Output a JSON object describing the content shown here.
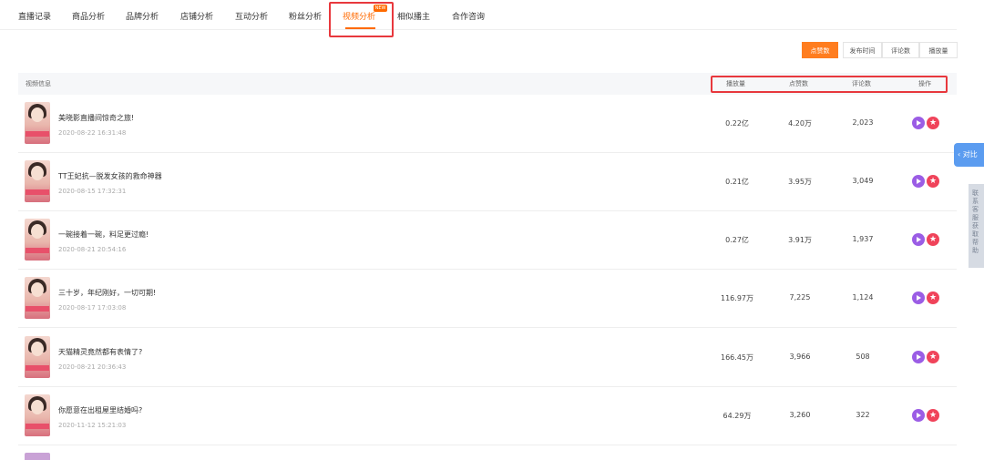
{
  "tabs": [
    {
      "label": "直播记录"
    },
    {
      "label": "商品分析"
    },
    {
      "label": "品牌分析"
    },
    {
      "label": "店铺分析"
    },
    {
      "label": "互动分析"
    },
    {
      "label": "粉丝分析"
    },
    {
      "label": "视频分析",
      "active": true,
      "badge": "NEW"
    },
    {
      "label": "相似播主"
    },
    {
      "label": "合作咨询"
    }
  ],
  "sort_buttons": [
    "点赞数",
    "发布时间",
    "评论数",
    "播放量"
  ],
  "table": {
    "headers": {
      "info": "视频信息",
      "plays": "播放量",
      "likes": "点赞数",
      "comments": "评论数",
      "actions": "操作"
    },
    "rows": [
      {
        "title": "美晓影直播间惊奇之旅!",
        "date": "2020-08-22 16:31:48",
        "plays": "0.22亿",
        "likes": "4.20万",
        "comments": "2,023"
      },
      {
        "title": "TT王妃抗—脱发女孩的救命神器",
        "date": "2020-08-15 17:32:31",
        "plays": "0.21亿",
        "likes": "3.95万",
        "comments": "3,049"
      },
      {
        "title": "一碗接着一碗，料足更过瘾!",
        "date": "2020-08-21 20:54:16",
        "plays": "0.27亿",
        "likes": "3.91万",
        "comments": "1,937"
      },
      {
        "title": "三十岁，年纪刚好，一切可期!",
        "date": "2020-08-17 17:03:08",
        "plays": "116.97万",
        "likes": "7,225",
        "comments": "1,124"
      },
      {
        "title": "天猫精灵竟然都有表情了?",
        "date": "2020-08-21 20:36:43",
        "plays": "166.45万",
        "likes": "3,966",
        "comments": "508"
      },
      {
        "title": "你愿意在出租屋里结婚吗?",
        "date": "2020-11-12 15:21:03",
        "plays": "64.29万",
        "likes": "3,260",
        "comments": "322"
      }
    ]
  },
  "actions": {
    "play_icon": "play-icon",
    "collect_icon": "star-icon"
  },
  "side": {
    "compare_label": "对比",
    "panel_label": "联系客服获取帮助"
  },
  "colors": {
    "accent": "#ff6a00",
    "highlight": "#e8383d",
    "play": "#9b5de5",
    "star": "#f0435a",
    "compare": "#5b9cf0"
  }
}
